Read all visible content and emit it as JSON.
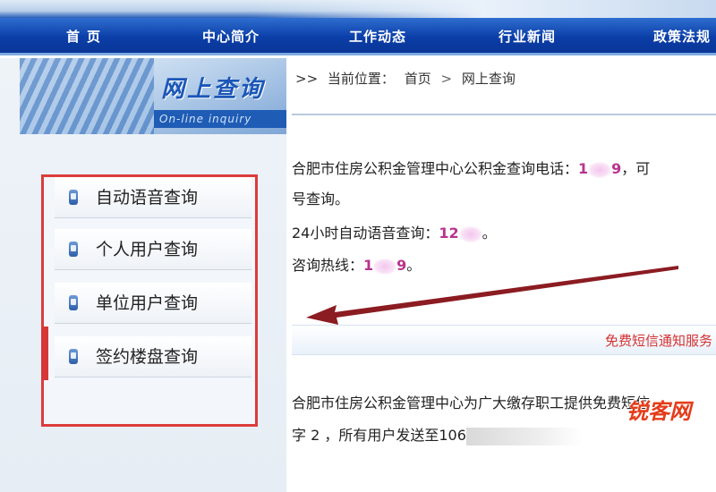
{
  "nav": {
    "items": [
      {
        "label": "首页"
      },
      {
        "label": "中心简介"
      },
      {
        "label": "工作动态"
      },
      {
        "label": "行业新闻"
      },
      {
        "label": "政策法规"
      }
    ]
  },
  "sidebar": {
    "title": "网上查询",
    "subtitle": "On-line inquiry",
    "items": [
      {
        "label": "自动语音查询"
      },
      {
        "label": "个人用户查询"
      },
      {
        "label": "单位用户查询"
      },
      {
        "label": "签约楼盘查询"
      }
    ]
  },
  "breadcrumb": {
    "prefix": ">>",
    "label": "当前位置：",
    "home": "首页",
    "separator": ">",
    "current": "网上查询"
  },
  "content": {
    "line1_text": "合肥市住房公积金管理中心公积金查询电话：",
    "line1_num_a": "1",
    "line1_num_b": "9",
    "line1_tail": "，可",
    "line2_text": "号查询。",
    "line3_text": "24小时自动语音查询：",
    "line3_num": "12",
    "line3_tail": "。",
    "line4_text": "咨询热线：",
    "line4_num_a": "1",
    "line4_num_b": "9",
    "line4_tail": "。",
    "notice": "免费短信通知服务",
    "line5_text": "合肥市住房公积金管理中心为广大缴存职工提供免费短信",
    "line6_text": "字 2 ，所有用户发送至106"
  },
  "watermark": "锐客网",
  "colors": {
    "nav_bg": "#0b3fa8",
    "highlight_border": "#dd3b3b",
    "pink_text": "#b8338e",
    "notice_red": "#d63232",
    "arrow": "#8b1c22"
  }
}
